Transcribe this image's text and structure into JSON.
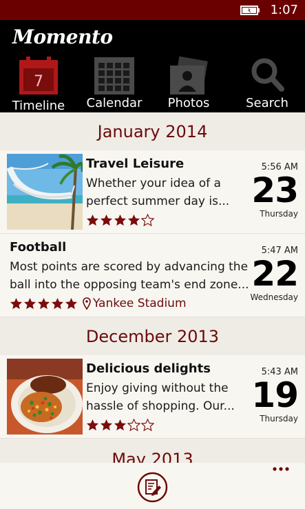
{
  "status": {
    "time": "1:07"
  },
  "app": {
    "name": "Momento"
  },
  "nav": {
    "timeline": {
      "label": "Timeline",
      "calendar_day": "7"
    },
    "calendar": {
      "label": "Calendar"
    },
    "photos": {
      "label": "Photos"
    },
    "search": {
      "label": "Search"
    }
  },
  "sections": [
    {
      "month": "January 2014",
      "entries": [
        {
          "title": "Travel Leisure",
          "desc1": "Whether your idea of a",
          "desc2": "perfect summer day is...",
          "rating": 4,
          "time": "5:56 AM",
          "day": "23",
          "weekday": "Thursday",
          "thumb": "beach-hammock"
        },
        {
          "title": "Football",
          "desc1": "Most points are scored by advancing the",
          "desc2": "ball into the opposing team's end zone...",
          "rating": 5,
          "location": "Yankee Stadium",
          "time": "5:47 AM",
          "day": "22",
          "weekday": "Wednesday"
        }
      ]
    },
    {
      "month": "December 2013",
      "entries": [
        {
          "title": "Delicious delights",
          "desc1": "Enjoy giving without the",
          "desc2": "hassle of shopping. Our...",
          "rating": 3,
          "time": "5:43 AM",
          "day": "19",
          "weekday": "Thursday",
          "thumb": "food-plate"
        }
      ]
    },
    {
      "month": "May 2013"
    }
  ],
  "colors": {
    "accent": "#6b0a0a",
    "statusbar": "#6b0000",
    "header": "#000000",
    "star": "#7a0c0c"
  },
  "appbar": {
    "primary_icon": "new-entry-icon",
    "more_icon": "more-icon"
  }
}
